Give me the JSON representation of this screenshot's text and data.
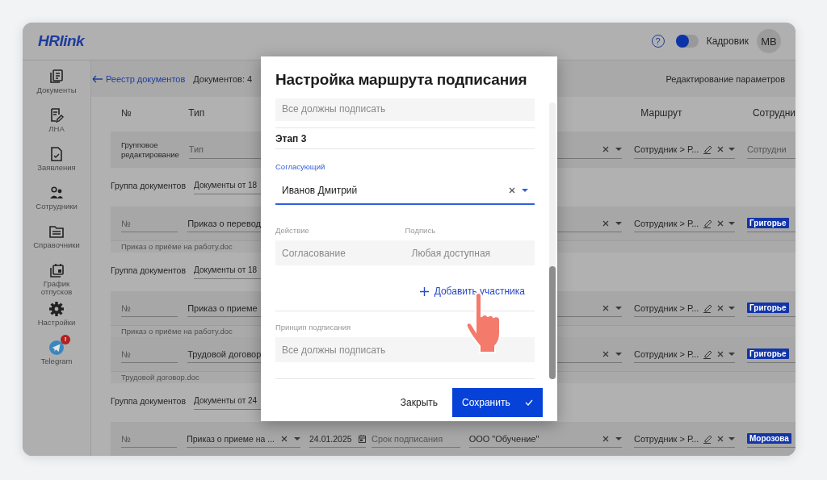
{
  "header": {
    "logo": "HRlink",
    "help": "?",
    "role_toggle": {
      "on": false
    },
    "role": "Кадровик",
    "avatar": "МВ"
  },
  "sidebar": {
    "items": [
      {
        "label": "Документы",
        "selected": false
      },
      {
        "label": "ЛНА",
        "selected": false
      },
      {
        "label": "Заявления",
        "selected": false
      },
      {
        "label": "Сотрудники",
        "selected": false
      },
      {
        "label": "Справочники",
        "selected": false
      },
      {
        "label": "График отпусков",
        "selected": false
      },
      {
        "label": "Настройки",
        "selected": false
      },
      {
        "label": "Telegram",
        "selected": false,
        "badge": "!"
      }
    ]
  },
  "breadcrumb": {
    "back_link": "Реестр документов",
    "count": "Документов: 4",
    "action": "Редактирование параметров"
  },
  "table": {
    "columns": [
      "№",
      "Тип",
      "Маршрут",
      "Сотрудни"
    ],
    "group_edit": {
      "label": "Групповое редактирование",
      "type_placeholder": "Тип",
      "route": "Сотрудник > Р...",
      "employee_placeholder": "Сотрудни"
    },
    "groups": [
      {
        "label": "Группа документов",
        "name": "Документы от 18",
        "documents": [
          {
            "number_placeholder": "№",
            "type": "Приказ о перевод",
            "route": "Сотрудник > Р...",
            "employee": "Григорье",
            "file": "Приказ о приёме на работу.doc"
          }
        ]
      },
      {
        "label": "Группа документов",
        "name": "Документы от 18",
        "documents": [
          {
            "number_placeholder": "№",
            "type": "Приказ о приеме",
            "route": "Сотрудник > Р...",
            "employee": "Григорье",
            "file": "Приказ о приёме на работу.doc"
          },
          {
            "number_placeholder": "№",
            "type": "Трудовой договор",
            "route": "Сотрудник > Р...",
            "employee": "Григорье",
            "file": "Трудовой договор.doc"
          }
        ]
      },
      {
        "label": "Группа документов",
        "name": "Документы от 24",
        "documents": [
          {
            "number_placeholder": "№",
            "type": "Приказ о приеме на ...",
            "date": "24.01.2025",
            "deadline_placeholder": "Срок подписания",
            "organization": "ООО \"Обучение\"",
            "route": "Сотрудник > Р...",
            "employee": "Морозова"
          }
        ]
      }
    ]
  },
  "modal": {
    "title": "Настройка маршрута подписания",
    "prev_principle": "Все должны подписать",
    "stage": "Этап 3",
    "approver": {
      "label": "Согласующий",
      "value": "Иванов Дмитрий",
      "focused": true
    },
    "action": {
      "label": "Действие",
      "value": "Согласование"
    },
    "signature": {
      "label": "Подпись",
      "value": "Любая доступная"
    },
    "add_participant": "Добавить участника",
    "principle": {
      "label": "Принцип подписания",
      "value": "Все должны подписать"
    },
    "buttons": {
      "close": "Закрыть",
      "save": "Сохранить"
    }
  }
}
